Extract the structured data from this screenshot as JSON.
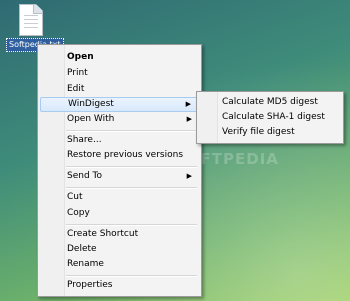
{
  "desktop": {
    "file_label": "Softpedia.txt",
    "watermark": "SOFTPEDIA"
  },
  "context_menu": {
    "items": [
      {
        "label": "Open"
      },
      {
        "label": "Print"
      },
      {
        "label": "Edit"
      },
      {
        "label": "WinDigest"
      },
      {
        "label": "Open With"
      },
      {
        "label": "Share..."
      },
      {
        "label": "Restore previous versions"
      },
      {
        "label": "Send To"
      },
      {
        "label": "Cut"
      },
      {
        "label": "Copy"
      },
      {
        "label": "Create Shortcut"
      },
      {
        "label": "Delete"
      },
      {
        "label": "Rename"
      },
      {
        "label": "Properties"
      }
    ],
    "submenu_arrow": "▶"
  },
  "submenu": {
    "items": [
      {
        "label": "Calculate MD5 digest"
      },
      {
        "label": "Calculate SHA-1 digest"
      },
      {
        "label": "Verify file digest"
      }
    ]
  }
}
